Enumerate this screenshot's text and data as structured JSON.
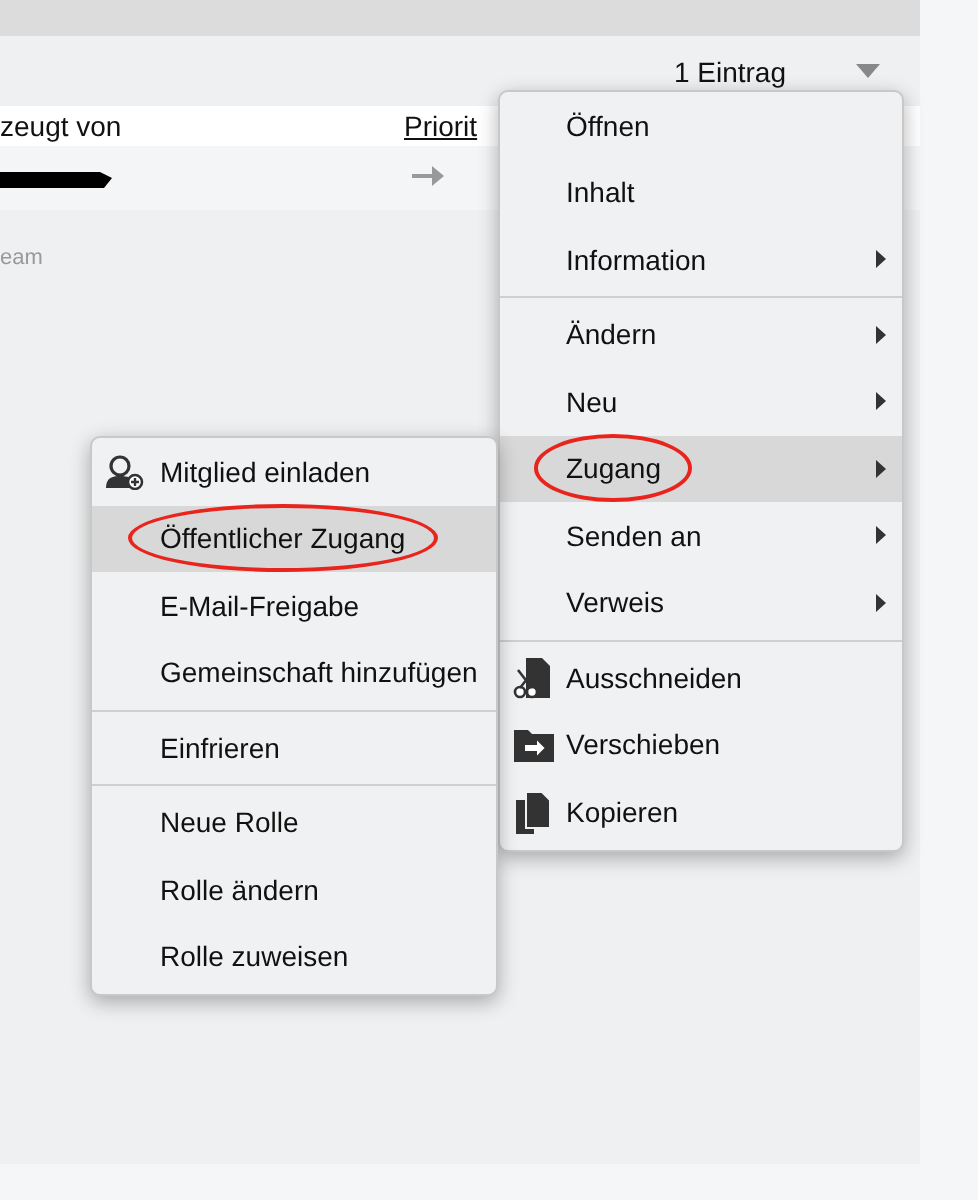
{
  "list_header": {
    "count": "1 Eintrag"
  },
  "table": {
    "columns": [
      "zeugt von",
      "Priorit"
    ],
    "rows": [
      {
        "column_2_arrow": true
      }
    ],
    "footer_text": "eam"
  },
  "context_menu": {
    "items": [
      {
        "kind": "item",
        "label": "Öffnen",
        "has_submenu": false,
        "selected": false
      },
      {
        "kind": "item",
        "label": "Inhalt",
        "has_submenu": false,
        "selected": false
      },
      {
        "kind": "item",
        "label": "Information",
        "has_submenu": true,
        "selected": false
      },
      {
        "kind": "separator"
      },
      {
        "kind": "item",
        "label": "Ändern",
        "has_submenu": true,
        "selected": false
      },
      {
        "kind": "item",
        "label": "Neu",
        "has_submenu": true,
        "selected": false
      },
      {
        "kind": "item",
        "label": "Zugang",
        "has_submenu": true,
        "selected": true,
        "circled": true
      },
      {
        "kind": "item",
        "label": "Senden an",
        "has_submenu": true,
        "selected": false
      },
      {
        "kind": "item",
        "label": "Verweis",
        "has_submenu": true,
        "selected": false
      },
      {
        "kind": "separator"
      },
      {
        "kind": "icon_item",
        "label": "Ausschneiden",
        "has_submenu": false,
        "selected": false
      },
      {
        "kind": "icon_item",
        "label": "Verschieben",
        "has_submenu": false,
        "selected": false
      },
      {
        "kind": "icon_item",
        "label": "Kopieren",
        "has_submenu": false,
        "selected": false
      }
    ]
  },
  "submenu": {
    "items": [
      {
        "kind": "icon_item",
        "label": "Mitglied einladen",
        "has_submenu": false,
        "selected": false
      },
      {
        "kind": "item",
        "label": "Öffentlicher Zugang",
        "has_submenu": false,
        "selected": true,
        "circled": true
      },
      {
        "kind": "item",
        "label": "E-Mail-Freigabe",
        "has_submenu": false,
        "selected": false
      },
      {
        "kind": "item",
        "label": "Gemeinschaft hinzufügen",
        "has_submenu": false,
        "selected": false
      },
      {
        "kind": "separator"
      },
      {
        "kind": "item",
        "label": "Einfrieren",
        "has_submenu": false,
        "selected": false
      },
      {
        "kind": "separator"
      },
      {
        "kind": "item",
        "label": "Neue Rolle",
        "has_submenu": false,
        "selected": false
      },
      {
        "kind": "item",
        "label": "Rolle ändern",
        "has_submenu": false,
        "selected": false
      },
      {
        "kind": "item",
        "label": "Rolle zuweisen",
        "has_submenu": false,
        "selected": false
      }
    ]
  }
}
